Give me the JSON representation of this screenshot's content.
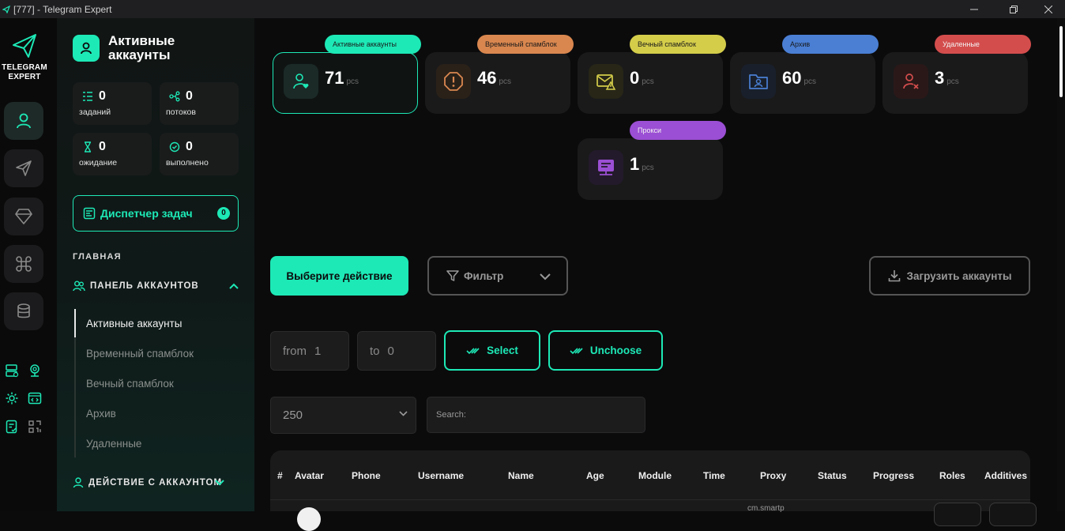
{
  "window": {
    "title": "[777] - Telegram Expert",
    "controls": [
      "minimize",
      "restore",
      "close"
    ]
  },
  "rail": {
    "logo_line1": "TELEGRAM",
    "logo_line2": "EXPERT",
    "buttons": [
      {
        "icon": "user-icon",
        "active": true
      },
      {
        "icon": "send-icon",
        "active": false
      },
      {
        "icon": "diamond-icon",
        "active": false
      },
      {
        "icon": "command-icon",
        "active": false
      },
      {
        "icon": "database-icon",
        "active": false
      }
    ],
    "mini_icons": [
      "server-icon",
      "webcam-icon",
      "gear-icon",
      "code-window-icon",
      "checklist-icon",
      "qr-grid-icon"
    ]
  },
  "sidebar": {
    "title": "Активные аккаунты",
    "stats": [
      {
        "value": "0",
        "label": "заданий",
        "icon": "tasks-icon"
      },
      {
        "value": "0",
        "label": "потоков",
        "icon": "threads-icon"
      },
      {
        "value": "0",
        "label": "ожидание",
        "icon": "hourglass-icon"
      },
      {
        "value": "0",
        "label": "выполнено",
        "icon": "check-circle-icon"
      }
    ],
    "dispatcher": {
      "label": "Диспетчер задач",
      "count": "0"
    },
    "section_main": "ГЛАВНАЯ",
    "group_accounts": "ПАНЕЛЬ АККАУНТОВ",
    "sub_items": [
      "Активные аккаунты",
      "Временный спамблок",
      "Вечный спамблок",
      "Архив",
      "Удаленные"
    ],
    "group_actions": "ДЕЙСТВИЕ С АККАУНТОМ"
  },
  "cards": [
    {
      "tag": "Активные аккаунты",
      "value": "71",
      "unit": "pcs",
      "color": "#1de9b6",
      "icon": "user-heart-icon"
    },
    {
      "tag": "Временный спамблок",
      "value": "46",
      "unit": "pcs",
      "color": "#d9874f",
      "icon": "octagon-warning-icon"
    },
    {
      "tag": "Вечный спамблок",
      "value": "0",
      "unit": "pcs",
      "color": "#d4cd4a",
      "icon": "mail-warning-icon"
    },
    {
      "tag": "Архив",
      "value": "60",
      "unit": "pcs",
      "color": "#4a7fd4",
      "icon": "folder-user-icon"
    },
    {
      "tag": "Удаленные",
      "value": "3",
      "unit": "pcs",
      "color": "#d44d4d",
      "icon": "user-x-icon"
    },
    {
      "tag": "Прокси",
      "value": "1",
      "unit": "pcs",
      "color": "#9b4fd4",
      "icon": "proxy-icon"
    }
  ],
  "actions": {
    "choose_action": "Выберите действие",
    "filter": "Фильтр",
    "upload": "Загрузить аккаунты"
  },
  "range": {
    "from_label": "from",
    "from_value": "1",
    "to_label": "to",
    "to_value": "0",
    "select": "Select",
    "unchoose": "Unchoose"
  },
  "paging": {
    "page_size": "250",
    "search_label": "Search:"
  },
  "table": {
    "columns": [
      "#",
      "Avatar",
      "Phone",
      "Username",
      "Name",
      "Age",
      "Module",
      "Time",
      "Proxy",
      "Status",
      "Progress",
      "Roles",
      "Additives"
    ],
    "partial_proxy": "cm.smartp"
  }
}
